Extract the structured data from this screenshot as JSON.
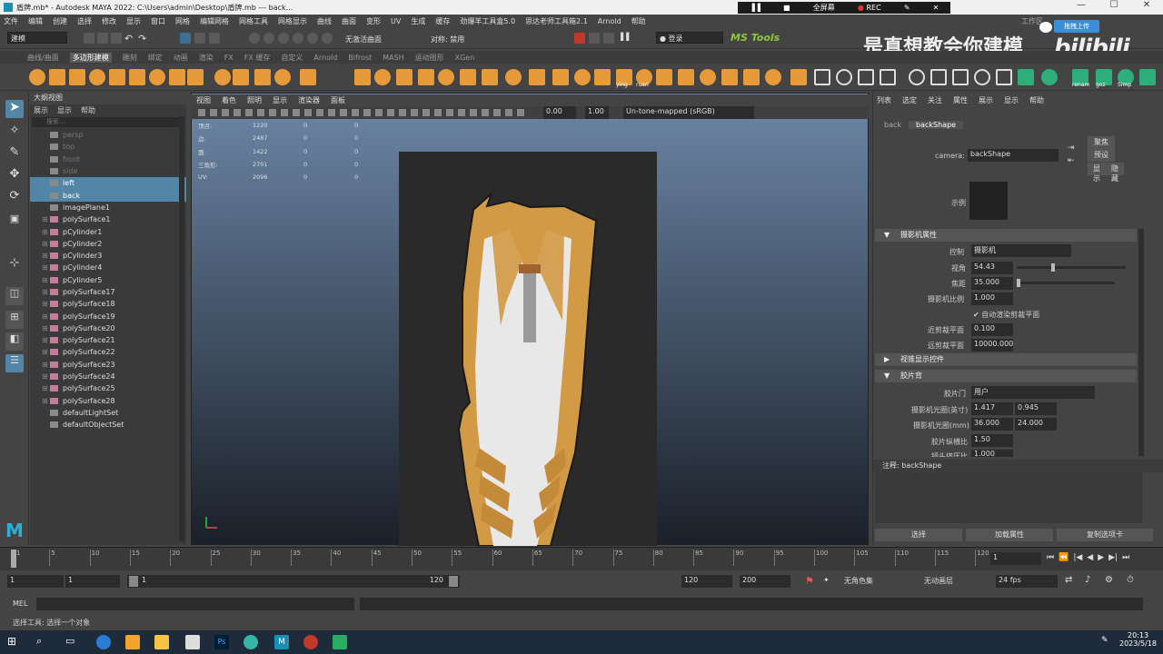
{
  "title_bar": {
    "icon": "maya-m-icon",
    "title": "盾牌.mb* - Autodesk MAYA 2022: C:\\Users\\admin\\Desktop\\盾牌.mb   ---   back...",
    "recorder": {
      "fullscreen": "全屏幕",
      "rec": "REC"
    }
  },
  "menubar": [
    "文件",
    "编辑",
    "创建",
    "选择",
    "修改",
    "显示",
    "窗口",
    "网格",
    "编辑网格",
    "网格工具",
    "网格显示",
    "曲线",
    "曲面",
    "变形",
    "UV",
    "生成",
    "缓存",
    "劲爆羊工具盒5.0",
    "思达老师工具箱2.1",
    "Arnold",
    "帮助"
  ],
  "workspace_label": "工作区",
  "status": {
    "mode": "建模",
    "symmetry_label": "对称: 禁用",
    "live_surface": "无激活曲面",
    "login": "登录",
    "mstools": "MS Tools"
  },
  "shelf_tabs": [
    "曲线/曲面",
    "多边形建模",
    "雕刻",
    "绑定",
    "动画",
    "渲染",
    "FX",
    "FX 缓存",
    "自定义",
    "Arnold",
    "Bifrost",
    "MASH",
    "运动图形",
    "XGen"
  ],
  "shelf_active": "多边形建模",
  "shelf_labels": [
    "ying",
    "ruan",
    "renam",
    "goz",
    "Simp"
  ],
  "watermark": "是真想教会你建模",
  "bilibili": {
    "badge": "拖拽上传",
    "logo": "bilibili"
  },
  "outliner": {
    "title": "大纲视图",
    "menu": [
      "展示",
      "显示",
      "帮助"
    ],
    "search_placeholder": "搜索...",
    "items": [
      {
        "name": "persp",
        "dim": true,
        "sel": false,
        "plus": false
      },
      {
        "name": "top",
        "dim": true,
        "sel": false,
        "plus": false
      },
      {
        "name": "front",
        "dim": true,
        "sel": false,
        "plus": false
      },
      {
        "name": "side",
        "dim": true,
        "sel": false,
        "plus": false
      },
      {
        "name": "left",
        "dim": true,
        "sel": true,
        "plus": false
      },
      {
        "name": "back",
        "dim": true,
        "sel": true,
        "plus": false
      },
      {
        "name": "imagePlane1",
        "dim": false,
        "sel": false,
        "plus": false
      },
      {
        "name": "polySurface1",
        "dim": false,
        "sel": false,
        "plus": true
      },
      {
        "name": "pCylinder1",
        "dim": false,
        "sel": false,
        "plus": true
      },
      {
        "name": "pCylinder2",
        "dim": false,
        "sel": false,
        "plus": true
      },
      {
        "name": "pCylinder3",
        "dim": false,
        "sel": false,
        "plus": true
      },
      {
        "name": "pCylinder4",
        "dim": false,
        "sel": false,
        "plus": true
      },
      {
        "name": "pCylinder5",
        "dim": false,
        "sel": false,
        "plus": true
      },
      {
        "name": "polySurface17",
        "dim": false,
        "sel": false,
        "plus": true
      },
      {
        "name": "polySurface18",
        "dim": false,
        "sel": false,
        "plus": true
      },
      {
        "name": "polySurface19",
        "dim": false,
        "sel": false,
        "plus": true
      },
      {
        "name": "polySurface20",
        "dim": false,
        "sel": false,
        "plus": true
      },
      {
        "name": "polySurface21",
        "dim": false,
        "sel": false,
        "plus": true
      },
      {
        "name": "polySurface22",
        "dim": false,
        "sel": false,
        "plus": true
      },
      {
        "name": "polySurface23",
        "dim": false,
        "sel": false,
        "plus": true
      },
      {
        "name": "polySurface24",
        "dim": false,
        "sel": false,
        "plus": true
      },
      {
        "name": "polySurface25",
        "dim": false,
        "sel": false,
        "plus": true
      },
      {
        "name": "polySurface28",
        "dim": false,
        "sel": false,
        "plus": true
      },
      {
        "name": "defaultLightSet",
        "dim": false,
        "sel": false,
        "plus": false
      },
      {
        "name": "defaultObjectSet",
        "dim": false,
        "sel": false,
        "plus": false
      }
    ]
  },
  "viewport": {
    "menu": [
      "视图",
      "着色",
      "照明",
      "显示",
      "渲染器",
      "面板"
    ],
    "exposure": "0.00",
    "gamma": "1.00",
    "colorspace": "Un-tone-mapped (sRGB)",
    "hud": [
      [
        "顶点:",
        "1220",
        "0",
        "0"
      ],
      [
        "边:",
        "2487",
        "0",
        "0"
      ],
      [
        "面:",
        "1422",
        "0",
        "0"
      ],
      [
        "三角形:",
        "2701",
        "0",
        "0"
      ],
      [
        "UV:",
        "2096",
        "0",
        "0"
      ]
    ]
  },
  "attr": {
    "menu": [
      "列表",
      "选定",
      "关注",
      "属性",
      "展示",
      "显示",
      "帮助"
    ],
    "tabs": [
      "back",
      "backShape"
    ],
    "camera_label": "camera:",
    "camera_value": "backShape",
    "btns": [
      "聚焦",
      "预设",
      "显示",
      "隐藏"
    ],
    "sample_label": "示例",
    "sections": {
      "cam": "摄影机属性",
      "frustum": "视锥显示控件",
      "film": "胶片背"
    },
    "control_label": "控制",
    "control_value": "摄影机",
    "angle_label": "视角",
    "angle_value": "54.43",
    "focal_label": "焦距",
    "focal_value": "35.000",
    "scale_label": "摄影机比例",
    "scale_value": "1.000",
    "autoclip": "自动渲染剪裁平面",
    "near_label": "近剪裁平面",
    "near_value": "0.100",
    "far_label": "远剪裁平面",
    "far_value": "10000.000",
    "gate_label": "胶片门",
    "gate_value": "用户",
    "aperture_in_label": "摄影机光圈(英寸)",
    "aperture_in": [
      "1.417",
      "0.945"
    ],
    "aperture_mm_label": "摄影机光圈(mm)",
    "aperture_mm": [
      "36.000",
      "24.000"
    ],
    "aspect_label": "胶片纵横比",
    "aspect_value": "1.50",
    "lens_label": "镜头挤压比",
    "lens_value": "1.000",
    "notes_label": "注释:",
    "notes_value": "backShape",
    "bottom_btns": [
      "选择",
      "加载属性",
      "复制选项卡"
    ]
  },
  "timeline": {
    "ticks": [
      "1",
      "5",
      "10",
      "15",
      "20",
      "25",
      "30",
      "35",
      "40",
      "45",
      "50",
      "55",
      "60",
      "65",
      "70",
      "75",
      "80",
      "85",
      "90",
      "95",
      "100",
      "105",
      "110",
      "115",
      "120"
    ],
    "current": "1"
  },
  "range": {
    "start": "1",
    "start2": "1",
    "slider_start": "1",
    "slider_end": "120",
    "end": "120",
    "end2": "200",
    "char_set": "无角色集",
    "anim_layer": "无动画层",
    "fps": "24 fps"
  },
  "mel": {
    "label": "MEL"
  },
  "help": {
    "text": "选择工具: 选择一个对象"
  },
  "taskbar": {
    "time": "20:13",
    "date": "2023/5/18"
  }
}
